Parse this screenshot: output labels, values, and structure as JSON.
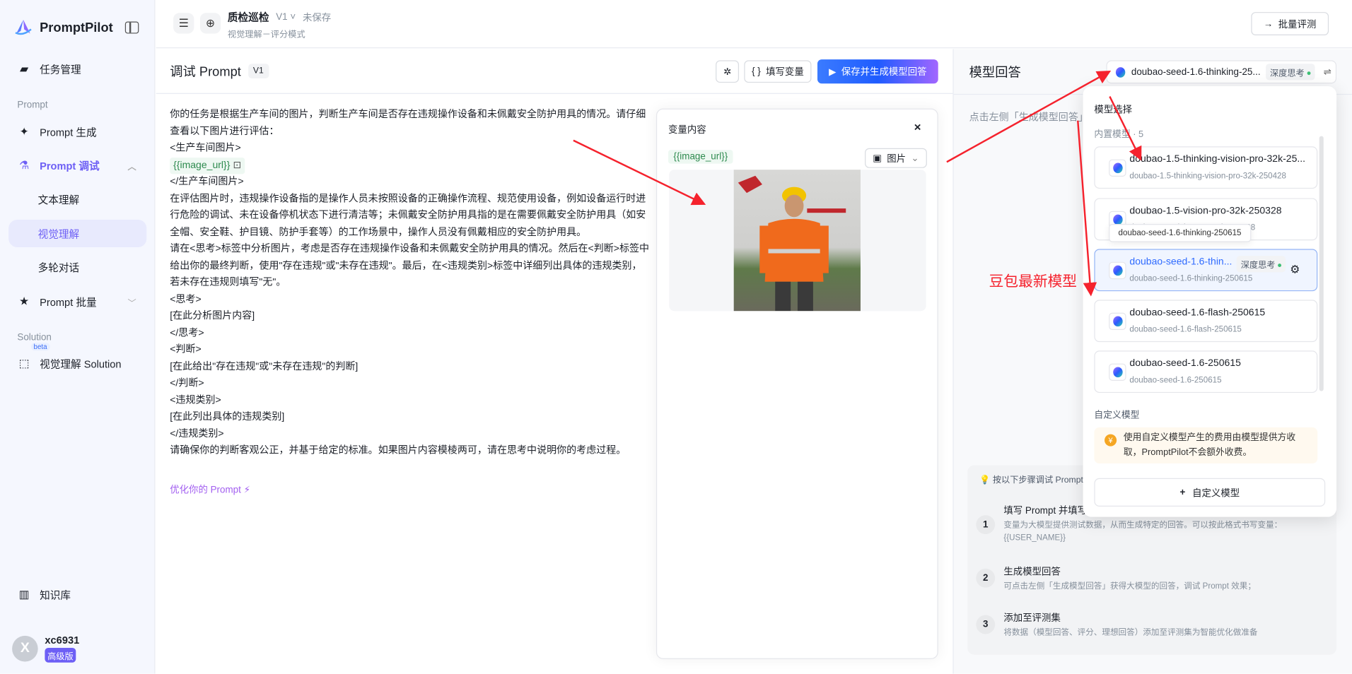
{
  "app": {
    "name": "PromptPilot"
  },
  "sidebar": {
    "task_mgmt": "任务管理",
    "section_prompt": "Prompt",
    "items": [
      {
        "label": "Prompt 生成"
      },
      {
        "label": "Prompt 调试"
      },
      {
        "label": "文本理解"
      },
      {
        "label": "视觉理解"
      },
      {
        "label": "多轮对话"
      },
      {
        "label": "Prompt 批量"
      }
    ],
    "section_solution": "Solution",
    "solution_item": "视觉理解 Solution",
    "beta": "beta",
    "knowledge": "知识库",
    "user": {
      "initial": "X",
      "name": "xc6931",
      "plan": "高级版"
    }
  },
  "header": {
    "title": "质检巡检",
    "version": "V1",
    "status": "未保存",
    "subtitle": "视觉理解－评分模式",
    "batch_eval": "批量评测"
  },
  "editor": {
    "title": "调试 Prompt",
    "version": "V1",
    "fill_vars": "填写变量",
    "save_generate": "保存并生成模型回答",
    "lines": [
      "你的任务是根据生产车间的图片，判断生产车间是否存在违规操作设备和未佩戴安全防护用具的情况。请仔细查看以下图片进行评估：",
      "<生产车间图片>",
      "{{image_url}}",
      "</生产车间图片>",
      "在评估图片时，违规操作设备指的是操作人员未按照设备的正确操作流程、规范使用设备，例如设备运行时进行危险的调试、未在设备停机状态下进行清洁等；未佩戴安全防护用具指的是在需要佩戴安全防护用具（如安全帽、安全鞋、护目镜、防护手套等）的工作场景中，操作人员没有佩戴相应的安全防护用具。",
      "请在<思考>标签中分析图片，考虑是否存在违规操作设备和未佩戴安全防护用具的情况。然后在<判断>标签中给出你的最终判断，使用\"存在违规\"或\"未存在违规\"。最后，在<违规类别>标签中详细列出具体的违规类别，若未存在违规则填写\"无\"。",
      "<思考>",
      "[在此分析图片内容]",
      "</思考>",
      "<判断>",
      "[在此给出\"存在违规\"或\"未存在违规\"的判断]",
      "</判断>",
      "<违规类别>",
      "[在此列出具体的违规类别]",
      "</违规类别>",
      "请确保你的判断客观公正，并基于给定的标准。如果图片内容模棱两可，请在思考中说明你的考虑过程。"
    ],
    "optimize": "优化你的 Prompt"
  },
  "variables": {
    "title": "变量内容",
    "close": "×",
    "var_name": "{{image_url}}",
    "type": "图片"
  },
  "response": {
    "title": "模型回答",
    "hint": "点击左侧「生成模型回答」",
    "selected_model": "doubao-seed-1.6-thinking-25...",
    "selected_tag": "深度思考",
    "steps_title": "按以下步骤调试 Prompt",
    "steps": [
      {
        "n": "1",
        "title": "填写 Prompt 并填写变量",
        "desc": "变量为大模型提供测试数据，从而生成特定的回答。可以按此格式书写变量：{{USER_NAME}}"
      },
      {
        "n": "2",
        "title": "生成模型回答",
        "desc": "可点击左侧「生成模型回答」获得大模型的回答，调试 Prompt 效果；"
      },
      {
        "n": "3",
        "title": "添加至评测集",
        "desc": "将数据（模型回答、评分、理想回答）添加至评测集为智能优化做准备"
      }
    ]
  },
  "dropdown": {
    "title": "模型选择",
    "builtin": "内置模型",
    "count": "5",
    "models": [
      {
        "name": "doubao-1.5-thinking-vision-pro-32k-25...",
        "id": "doubao-1.5-thinking-vision-pro-32k-250428"
      },
      {
        "name": "doubao-1.5-vision-pro-32k-250328",
        "id": "doubao-1.5-vision-pro-32k-250328"
      },
      {
        "name": "doubao-seed-1.6-thin...",
        "id": "doubao-seed-1.6-thinking-250615",
        "tag": "深度思考"
      },
      {
        "name": "doubao-seed-1.6-flash-250615",
        "id": "doubao-seed-1.6-flash-250615"
      },
      {
        "name": "doubao-seed-1.6-250615",
        "id": "doubao-seed-1.6-250615"
      }
    ],
    "tooltip": "doubao-seed-1.6-thinking-250615",
    "custom": "自定义模型",
    "warning": "使用自定义模型产生的费用由模型提供方收取，PromptPilot不会额外收费。",
    "add_custom": "自定义模型"
  },
  "annotation": {
    "label": "豆包最新模型",
    "color": "#f5222d"
  }
}
